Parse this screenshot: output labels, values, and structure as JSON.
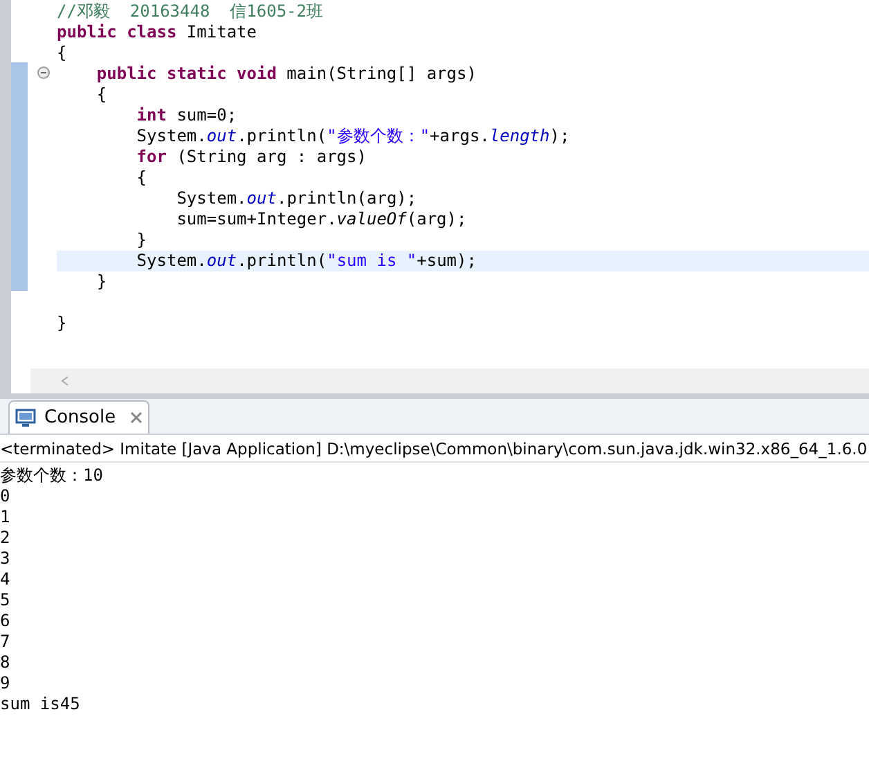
{
  "editor": {
    "lines": [
      {
        "current": false,
        "tokens": [
          {
            "kind": "comment",
            "text": "//邓毅  20163448  信1605-2班"
          }
        ]
      },
      {
        "current": false,
        "tokens": [
          {
            "kind": "keyword",
            "text": "public class"
          },
          {
            "kind": "plain",
            "text": " Imitate"
          }
        ]
      },
      {
        "current": false,
        "tokens": [
          {
            "kind": "plain",
            "text": "{"
          }
        ]
      },
      {
        "current": false,
        "tokens": [
          {
            "kind": "keyword",
            "text": "    public static void"
          },
          {
            "kind": "plain",
            "text": " main(String[] args)"
          }
        ]
      },
      {
        "current": false,
        "tokens": [
          {
            "kind": "plain",
            "text": "    {"
          }
        ]
      },
      {
        "current": false,
        "tokens": [
          {
            "kind": "keyword",
            "text": "        int"
          },
          {
            "kind": "plain",
            "text": " sum=0;"
          }
        ]
      },
      {
        "current": false,
        "tokens": [
          {
            "kind": "plain",
            "text": "        System."
          },
          {
            "kind": "field",
            "text": "out"
          },
          {
            "kind": "plain",
            "text": ".println("
          },
          {
            "kind": "string",
            "text": "\"参数个数：\""
          },
          {
            "kind": "plain",
            "text": "+args."
          },
          {
            "kind": "field",
            "text": "length"
          },
          {
            "kind": "plain",
            "text": ");"
          }
        ]
      },
      {
        "current": false,
        "tokens": [
          {
            "kind": "keyword",
            "text": "        for"
          },
          {
            "kind": "plain",
            "text": " (String arg : args)"
          }
        ]
      },
      {
        "current": false,
        "tokens": [
          {
            "kind": "plain",
            "text": "        {"
          }
        ]
      },
      {
        "current": false,
        "tokens": [
          {
            "kind": "plain",
            "text": "            System."
          },
          {
            "kind": "field",
            "text": "out"
          },
          {
            "kind": "plain",
            "text": ".println(arg);"
          }
        ]
      },
      {
        "current": false,
        "tokens": [
          {
            "kind": "plain",
            "text": "            sum=sum+Integer."
          },
          {
            "kind": "method",
            "text": "valueOf"
          },
          {
            "kind": "plain",
            "text": "(arg);"
          }
        ]
      },
      {
        "current": false,
        "tokens": [
          {
            "kind": "plain",
            "text": "        }"
          }
        ]
      },
      {
        "current": true,
        "tokens": [
          {
            "kind": "plain",
            "text": "        System."
          },
          {
            "kind": "field",
            "text": "out"
          },
          {
            "kind": "plain",
            "text": ".println("
          },
          {
            "kind": "string",
            "text": "\"sum is \""
          },
          {
            "kind": "plain",
            "text": "+sum);"
          }
        ]
      },
      {
        "current": false,
        "tokens": [
          {
            "kind": "plain",
            "text": "    }"
          }
        ]
      },
      {
        "current": false
      },
      {
        "current": false,
        "tokens": [
          {
            "kind": "plain",
            "text": "}"
          }
        ]
      }
    ]
  },
  "console": {
    "tab": {
      "label": "Console",
      "selected": true
    },
    "status": "<terminated> Imitate [Java Application] D:\\myeclipse\\Common\\binary\\com.sun.java.jdk.win32.x86_64_1.6.0",
    "output": [
      "参数个数：10",
      "0",
      "1",
      "2",
      "3",
      "4",
      "5",
      "6",
      "7",
      "8",
      "9",
      "sum is45"
    ]
  }
}
